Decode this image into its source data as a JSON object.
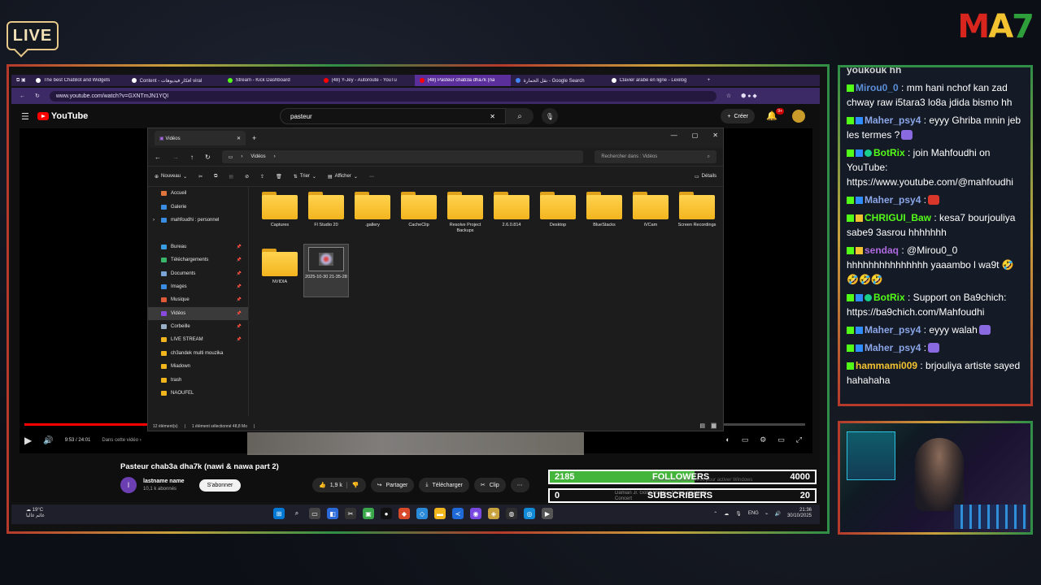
{
  "overlay": {
    "live_label": "LIVE",
    "logo": {
      "m": "M",
      "a": "A",
      "s": "7"
    }
  },
  "browser": {
    "tabs": [
      {
        "label": "The best ChatBot and Widgets",
        "color": "#ffffff"
      },
      {
        "label": "Content - أفكار فيديوهات viral",
        "color": "#ffffff"
      },
      {
        "label": "Stream - Kick Dashboard",
        "color": "#53fc18"
      },
      {
        "label": "(48) Y-Jey - Autoroute - YouTu",
        "color": "#ff0000"
      },
      {
        "label": "(48) Pasteur chab3a dha7k (na",
        "color": "#ff0000",
        "active": true
      },
      {
        "label": "نقل الحمارة - Google Search",
        "color": "#4285f4"
      },
      {
        "label": "Clavier arabe en ligne - Lexilog",
        "color": "#ffffff"
      }
    ],
    "url": "www.youtube.com/watch?v=GXNTmJN1YQI"
  },
  "youtube": {
    "logo_text": "YouTube",
    "search_value": "pasteur",
    "create_label": "Créer",
    "notif_count": "9+",
    "video_time": "9:53 / 24:01",
    "chapter": "Dans cette vidéo ›",
    "video_title": "Pasteur chab3a dha7k (nawi & nawa part 2)",
    "channel_initial": "l",
    "channel_name": "lastname name",
    "subs": "10,1 k abonnés",
    "subscribe_label": "S'abonner",
    "likes": "1,9 k",
    "share_label": "Partager",
    "download_label": "Télécharger",
    "clip_label": "Clip",
    "progress": 0.41
  },
  "explorer": {
    "tab_title": "Vidéos",
    "path_label": "Vidéos",
    "search_placeholder": "Rechercher dans : Vidéos",
    "tools": {
      "new": "Nouveau",
      "sort": "Trier",
      "view": "Afficher",
      "details": "Détails"
    },
    "sidebar": [
      {
        "label": "Accueil",
        "color": "#e0743a",
        "pin": false
      },
      {
        "label": "Galerie",
        "color": "#3a8de0",
        "pin": false
      },
      {
        "label": "mahfoudhi : personnel",
        "color": "#3a8de0",
        "pin": false,
        "expand": true
      },
      {
        "label": "",
        "color": "transparent",
        "pin": false
      },
      {
        "label": "Bureau",
        "color": "#3a9de0",
        "pin": true
      },
      {
        "label": "Téléchargements",
        "color": "#3ab56a",
        "pin": true
      },
      {
        "label": "Documents",
        "color": "#7aa3d8",
        "pin": true
      },
      {
        "label": "Images",
        "color": "#3a8de0",
        "pin": true
      },
      {
        "label": "Musique",
        "color": "#e05a3a",
        "pin": true
      },
      {
        "label": "Vidéos",
        "color": "#8a4ae0",
        "pin": true,
        "active": true
      },
      {
        "label": "Corbeille",
        "color": "#9ab0c8",
        "pin": true
      },
      {
        "label": "LIVE STREAM",
        "color": "#f3b51e",
        "pin": true
      },
      {
        "label": "ch3andek multi mouzika",
        "color": "#f3b51e",
        "pin": false
      },
      {
        "label": "Miadown",
        "color": "#f3b51e",
        "pin": false
      },
      {
        "label": "trash",
        "color": "#f3b51e",
        "pin": false
      },
      {
        "label": "NAOUFEL",
        "color": "#f3b51e",
        "pin": false
      }
    ],
    "folders": [
      {
        "label": "Captures"
      },
      {
        "label": "Fl Studio 20"
      },
      {
        "label": ".gallery"
      },
      {
        "label": "CacheClip"
      },
      {
        "label": "Resolve Project Backups"
      },
      {
        "label": "2.6.0.814"
      },
      {
        "label": "Desktop"
      },
      {
        "label": "BlueStacks"
      },
      {
        "label": "iVCam"
      },
      {
        "label": "Screen Recordings"
      },
      {
        "label": "NVIDIA"
      }
    ],
    "video_file": "2025-10-30 21-35-28",
    "status_count": "12 élément(s)",
    "status_selected": "1 élément sélectionné 48,8 Mo"
  },
  "taskbar": {
    "temp": "19°C",
    "weather_desc": "غائم غالبا",
    "lang": "ENG",
    "time": "21:36",
    "date": "30/10/2025"
  },
  "goals": {
    "followers": {
      "current": "2185",
      "label": "FOLLOWERS",
      "target": "4000",
      "progress": 0.546
    },
    "subscribers": {
      "current": "0",
      "label": "SUBSCRIBERS",
      "target": "20",
      "progress": 0.0
    },
    "ticker": "Damian Jr. Gong Marley - Music Tiny Desk Concert",
    "activate": "Accédez aux paramètres pour activer Windows"
  },
  "chat": {
    "messages": [
      {
        "user": "youkouk hh",
        "text": "",
        "color": "#ffffff",
        "badges": [],
        "partial": true
      },
      {
        "user": "Mirou0_0",
        "text": ": mm hani nchof kan zad chway raw i5tara3 lo8a jdida bismo hh",
        "color": "#5a8fd8",
        "badges": [
          "s"
        ]
      },
      {
        "user": "Maher_psy4",
        "text": ": eyyy Ghriba mnin jeb les termes ?",
        "color": "#8aa6e8",
        "badges": [
          "s",
          "b"
        ],
        "emote": "#8a6ae0"
      },
      {
        "user": "BotRix",
        "text": ": join Mahfoudhi on YouTube: https://www.youtube.com/@mahfoudhi",
        "color": "#53fc18",
        "badges": [
          "s",
          "b",
          "g"
        ]
      },
      {
        "user": "Maher_psy4",
        "text": ":",
        "color": "#8aa6e8",
        "badges": [
          "s",
          "b"
        ],
        "emote": "#d8372a"
      },
      {
        "user": "CHRIGUI_Baw",
        "text": ": kesa7 bourjouliya sabe9 3asrou hhhhhhh",
        "color": "#53fc18",
        "badges": [
          "s",
          "y"
        ]
      },
      {
        "user": "sendaq",
        "text": ": @Mirou0_0 hhhhhhhhhhhhhhh yaaambo l wa9t 🤣🤣🤣🤣",
        "color": "#b06ae0",
        "badges": [
          "s",
          "y"
        ]
      },
      {
        "user": "BotRix",
        "text": ": Support on Ba9chich: https://ba9chich.com/Mahfoudhi",
        "color": "#53fc18",
        "badges": [
          "s",
          "b",
          "g"
        ]
      },
      {
        "user": "Maher_psy4",
        "text": ": eyyy walah",
        "color": "#8aa6e8",
        "badges": [
          "s",
          "b"
        ],
        "emote": "#8a6ae0"
      },
      {
        "user": "Maher_psy4",
        "text": ":",
        "color": "#8aa6e8",
        "badges": [
          "s",
          "b"
        ],
        "emote": "#8a6ae0"
      },
      {
        "user": "hammami009",
        "text": ": brjouliya artiste sayed hahahaha",
        "color": "#f2c230",
        "badges": [
          "s"
        ]
      }
    ]
  }
}
